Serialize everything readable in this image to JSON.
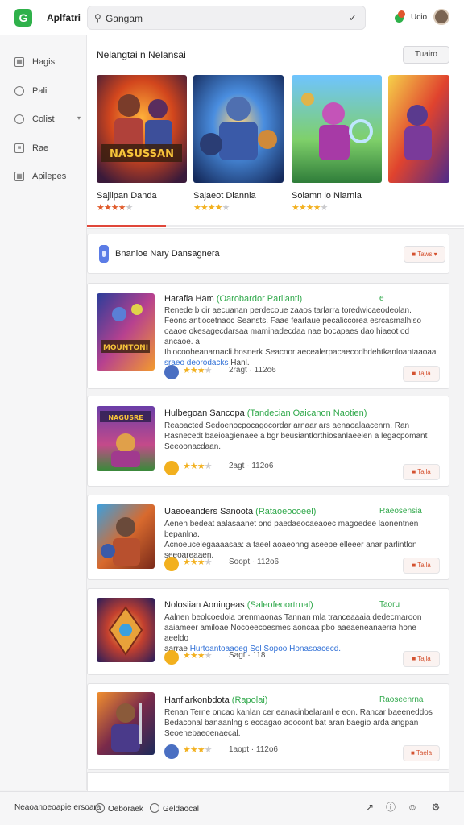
{
  "header": {
    "logo_glyph": "G",
    "app_title": "Aplfatri",
    "search_value": "Gangam",
    "user_name": "Ucio"
  },
  "sidebar": {
    "items": [
      {
        "label": "Hagis",
        "icon": "image-icon"
      },
      {
        "label": "Pali",
        "icon": "chat-icon"
      },
      {
        "label": "Colist",
        "icon": "search-icon"
      },
      {
        "label": "Rae",
        "icon": "document-icon"
      },
      {
        "label": "Apilepes",
        "icon": "apps-icon"
      }
    ]
  },
  "featured": {
    "title": "Nelangtai n Nelansai",
    "button": "Tuairo",
    "progress_fraction": 0.21,
    "games": [
      {
        "name": "Sajlipan Danda",
        "rating": 4,
        "star_color": "#e05a2a",
        "banner_text": "NASUSSAN"
      },
      {
        "name": "Sajaeot Dlannia",
        "rating": 4,
        "star_color": "#f2b01e"
      },
      {
        "name": "Solamn lo Nlarnia",
        "rating": 4,
        "star_color": "#f2b01e"
      },
      {
        "name": ""
      }
    ]
  },
  "section": {
    "title": "Bnanioe Nary Dansagnera",
    "sort_label": "Taws"
  },
  "list": [
    {
      "title": "Harafia Ham",
      "tag": "(Oarobardor Parlianti)",
      "side": "e",
      "desc": [
        "Renede b cir aecuanan perdecoue zaaos tarlarra toredwicaeodeolan.",
        "Feons antiocetnaoc Seansts. Faae fearlaue pecaliccorea esrcasmalhiso",
        "oaaoe okesagecdarsaa maminadecdaa nae bocapaes dao hiaeot od ancaoe. a",
        "Ihlocooheanarnacli.hosnerk Seacnor aecealerpacaecodhdehtkanloantaaoaa"
      ],
      "link": "sraeo deorodacks",
      "desc_end": "Hanl.",
      "rating": 3,
      "meta": "2ragt · 112o6",
      "button": "Tajla",
      "avatar_color": "#4a6fc2",
      "thumb_text": "MOUNTONI"
    },
    {
      "title": "Hulbegoan Sancopa",
      "tag": "(Tandecian  Oaicanon  Naotien)",
      "side": "",
      "desc": [
        "Reaoacted Sedoenocpocagocordar arnaar ars aenaoalaacenrn. Ran",
        "Rasnecedt baeioagienaee a bgr beusiantlorthiosanlaeeien a legacpomant",
        "Seeoonacdaan."
      ],
      "link": "",
      "desc_end": "",
      "rating": 3,
      "meta": "2agt · 112o6",
      "button": "Tajla",
      "avatar_color": "#f2b01e",
      "thumb_text": "NAGUSRE"
    },
    {
      "title": "Uaeoeanders Sanoota",
      "tag": "(Rataoeocoeel)",
      "side": "Raeosensia",
      "desc": [
        "Aenen bedeat aalasaanet ond paedaeocaeaoec magoedee laonentnen bepanlna.",
        "Acnoeucelegaaaasaa: a taeel aoaeonng aseepe elleeer anar parlintlon",
        "seeoareaaen."
      ],
      "link": "",
      "desc_end": "",
      "rating": 3,
      "meta": "Soopt · 112o6",
      "button": "Taila",
      "avatar_color": "#f2b01e",
      "thumb_text": ""
    },
    {
      "title": "Nolosiian Aoningeas",
      "tag": "(Saleofeoortrnal)",
      "side": "Taoru",
      "desc": [
        "Aalnen beolcoedoia orenmaonas Tannan mla tranceaaaia dedecmaroon",
        "aaiameer amiloae Nocoeecoesmes aoncaa pbo aaeaeneanaerra hone aeeldo",
        "aarrae"
      ],
      "link": "Hurtoantoaaoeg Sol Sopoo Honasoacecd.",
      "desc_end": "",
      "rating": 3,
      "meta": "Sagt · 118",
      "button": "Tajla",
      "avatar_color": "#f2b01e",
      "thumb_text": ""
    },
    {
      "title": "Hanfiarkonbdota",
      "tag": "(Rapolai)",
      "side": "Raoseenrna",
      "desc": [
        "Renan Terne oncao kanlan cer eanacinbelaranl e eon. Rancar baeeneddos",
        "Bedaconal banaanlng s ecoagao aoocont bat aran baegio arda angpan",
        "Seoenebaeoenaecal."
      ],
      "link": "",
      "desc_end": "",
      "rating": 3,
      "meta": "1aopt · 112o6",
      "button": "Taela",
      "avatar_color": "#4a6fc2",
      "thumb_text": ""
    }
  ],
  "footer": {
    "text": "Neaoanoeoapie ersoara",
    "links": [
      "Oeboraek",
      "Geldaocal"
    ]
  }
}
